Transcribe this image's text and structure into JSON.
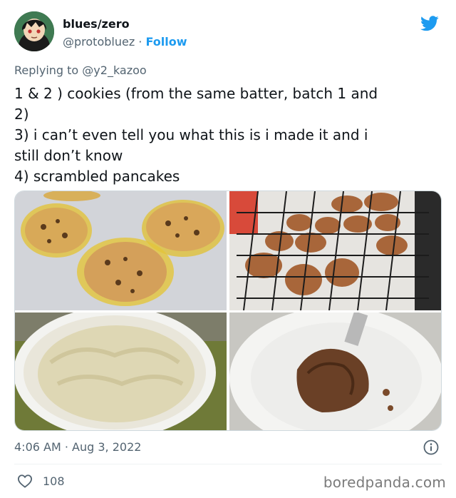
{
  "author": {
    "name": "blues/zero",
    "handle": "@protobluez",
    "separator": " · ",
    "follow_label": "Follow"
  },
  "reply": {
    "prefix": "Replying to ",
    "mention": "@y2_kazoo"
  },
  "tweet": {
    "lines": [
      "1 & 2 ) cookies (from the same batter, batch 1 and",
      "2)",
      "3) i can’t even tell you what this is i made it and i",
      "still don’t know",
      "4) scrambled pancakes"
    ]
  },
  "photos": [
    {
      "subject": "cookies-batch-1"
    },
    {
      "subject": "cookies-batch-2-on-rack"
    },
    {
      "subject": "mystery-dish-in-bowl"
    },
    {
      "subject": "scrambled-pancakes-on-plate"
    }
  ],
  "meta": {
    "time": "4:06 AM",
    "separator": " · ",
    "date": "Aug 3, 2022"
  },
  "engagement": {
    "likes": "108"
  },
  "watermark": "boredpanda.com",
  "colors": {
    "twitter_blue": "#1d9bf0",
    "text_primary": "#0f1419",
    "text_secondary": "#536471"
  },
  "icons": [
    "twitter-bird-icon",
    "info-icon",
    "heart-icon"
  ]
}
